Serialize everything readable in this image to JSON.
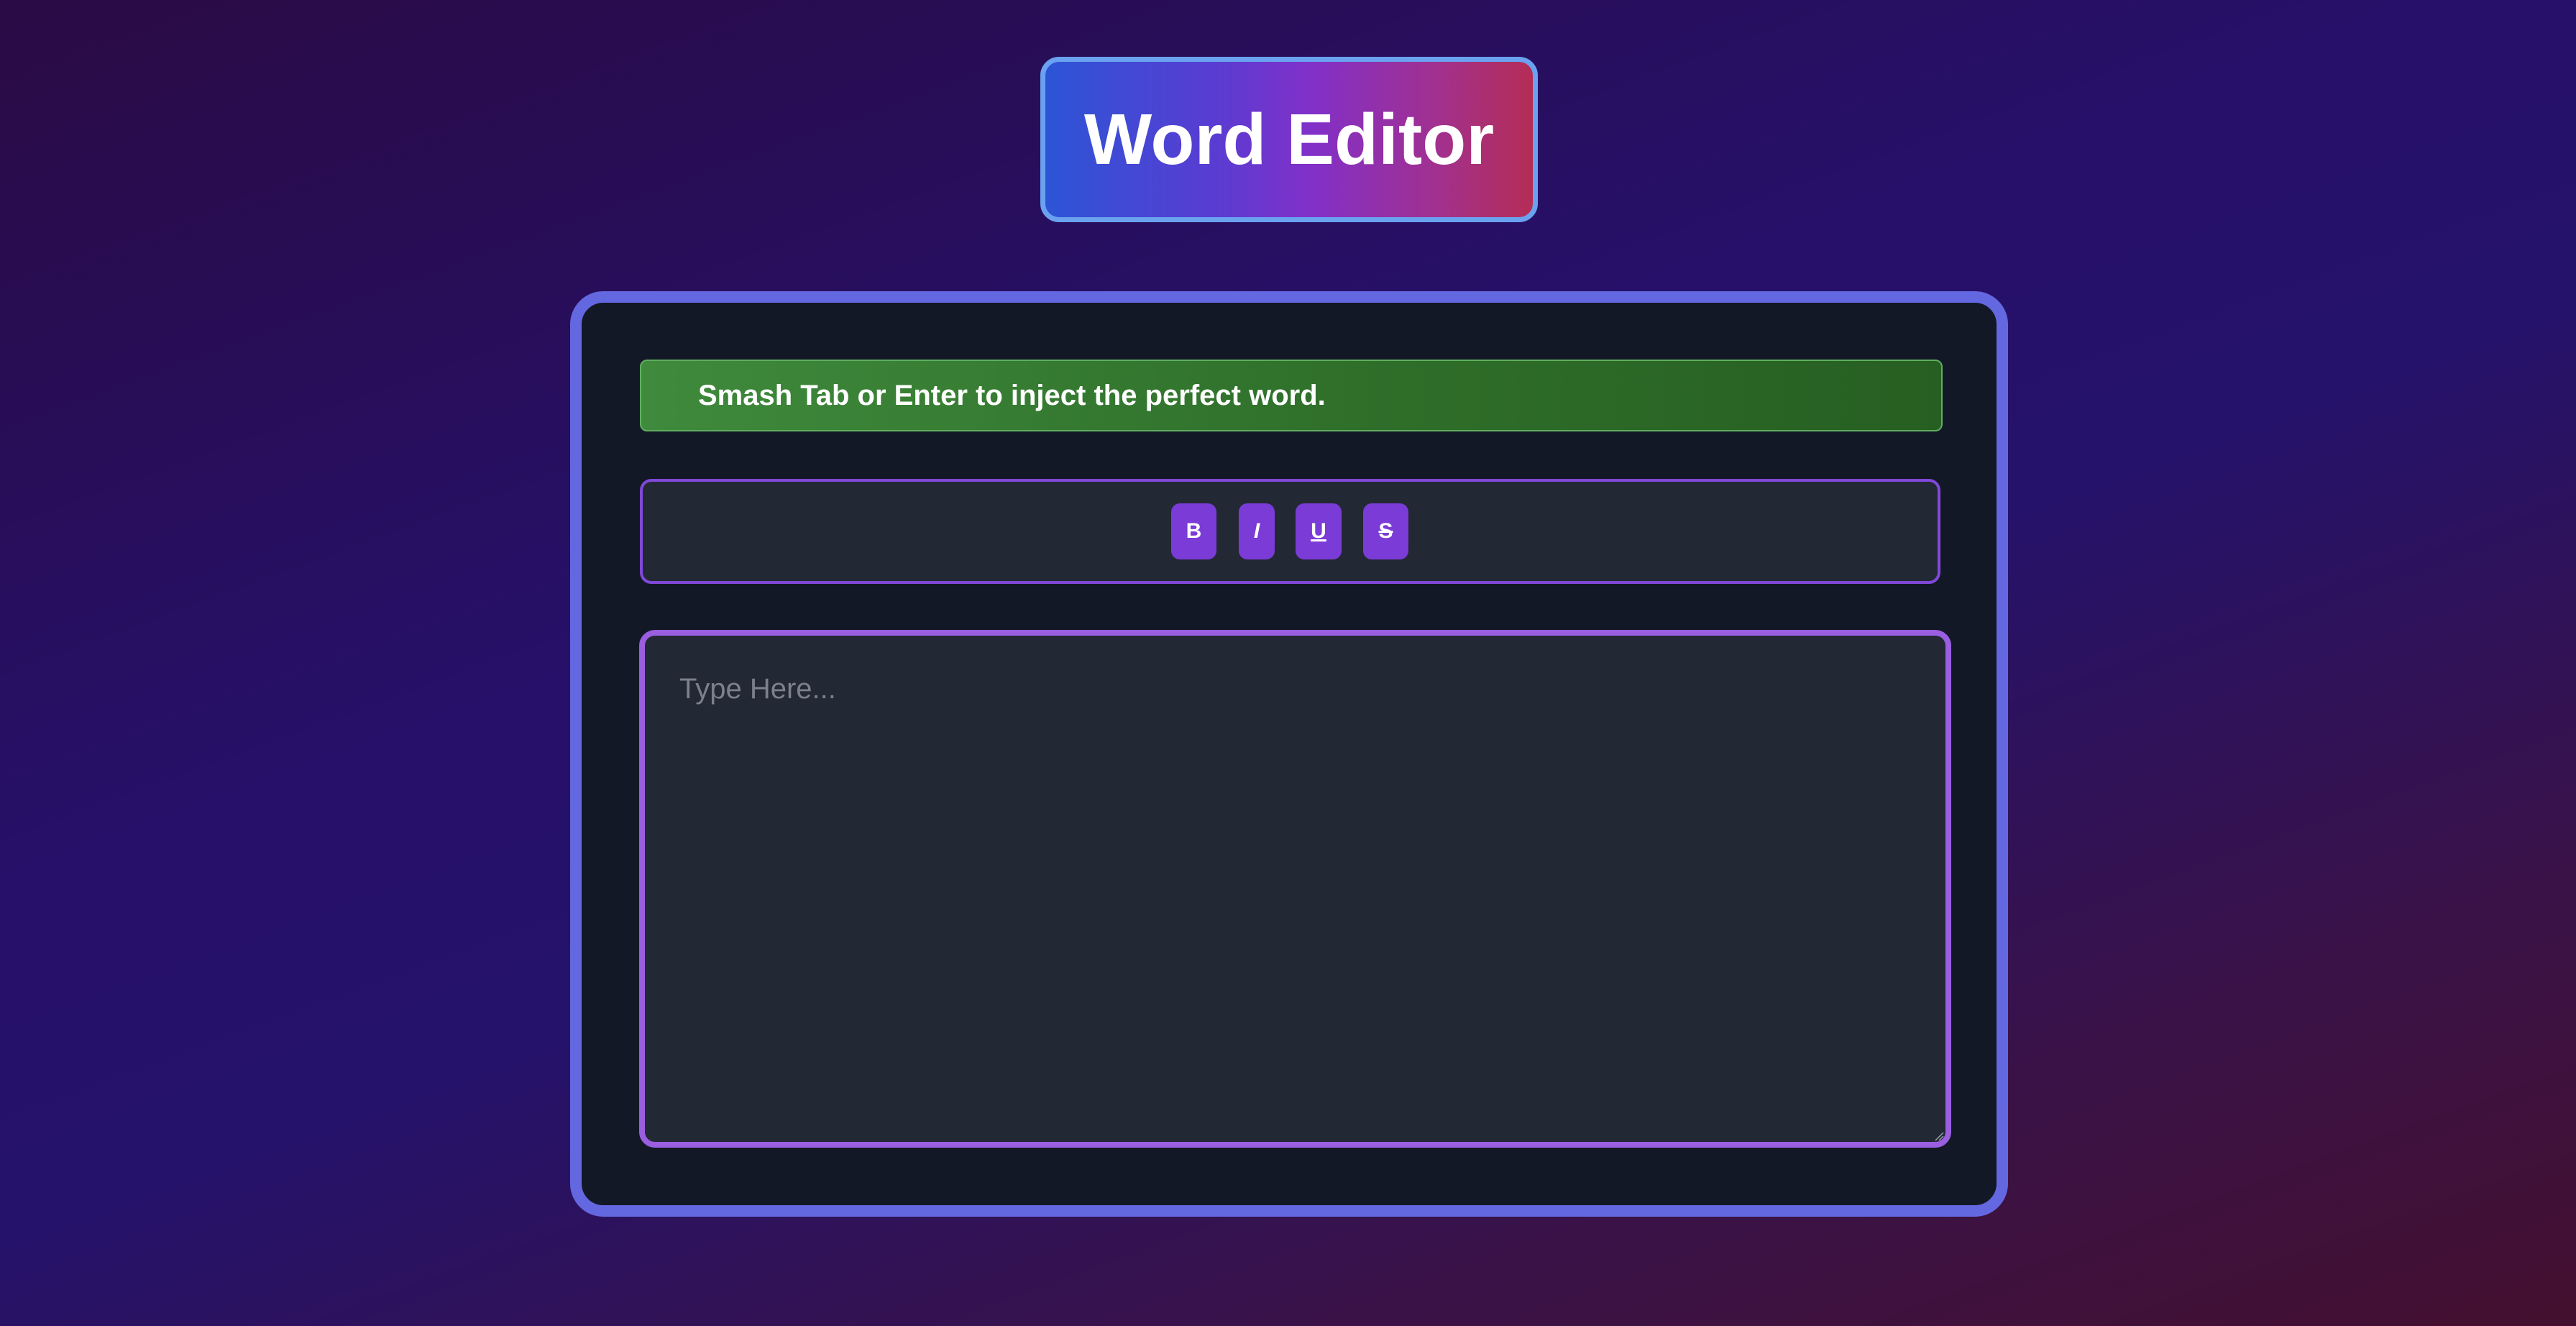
{
  "header": {
    "title": "Word Editor"
  },
  "hint": {
    "text": "Smash Tab or Enter to inject the perfect word."
  },
  "toolbar": {
    "bold_label": "B",
    "italic_label": "I",
    "underline_label": "U",
    "strike_label": "S"
  },
  "editor": {
    "value": "",
    "placeholder": "Type Here..."
  },
  "colors": {
    "panel_border": "#6468e0",
    "button": "#7b3bd6",
    "hint_green": "#3f8a3c",
    "editor_border": "#9a5ee0"
  }
}
